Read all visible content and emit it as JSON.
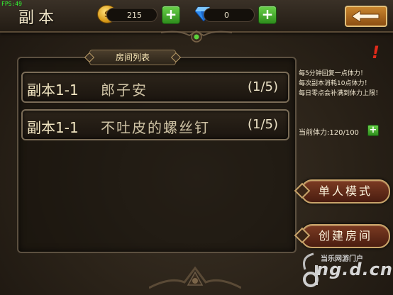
{
  "debug": {
    "fps": "FPS:49"
  },
  "header": {
    "title": "副本",
    "gold": {
      "icon": "gold-coin-icon",
      "value": "215"
    },
    "gems": {
      "icon": "diamond-icon",
      "value": "0"
    },
    "back_icon": "back-arrow-icon"
  },
  "room_list": {
    "tab_label": "房间列表",
    "rooms": [
      {
        "stage": "副本1-1",
        "name": "郎子安",
        "count": "(1/5)"
      },
      {
        "stage": "副本1-1",
        "name": "不吐皮的螺丝钉",
        "count": "(1/5)"
      }
    ]
  },
  "info": {
    "lines": [
      "每5分钟回复一点体力！",
      "每次副本消耗10点体力！",
      "每日零点会补满到体力上限！"
    ],
    "stamina_label": "当前体力:",
    "stamina_value": "120/100"
  },
  "actions": {
    "single_mode": "单人模式",
    "create_room": "创建房间"
  },
  "watermark": {
    "line1": "当乐网游门户",
    "line2": "ng.d.cn"
  },
  "colors": {
    "accent_gold": "#d99a18",
    "plus_green": "#3aa82a",
    "alert_red": "#e22b1b",
    "button_red": "#7b3a22"
  }
}
